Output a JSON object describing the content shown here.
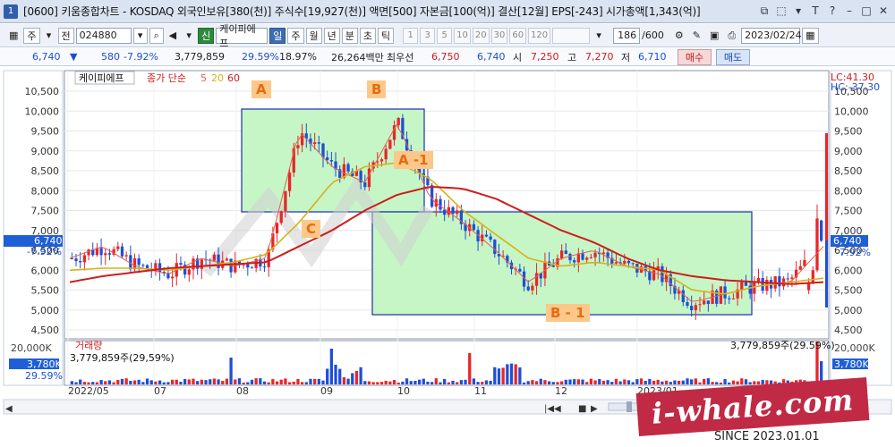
{
  "window": {
    "app_num": "1",
    "title": "[0600] 키움종합차트 - KOSDAQ 외국인보유[380(천)] 주식수[19,927(천)] 액면[500] 자본금[100(억)] 결산[12월] EPS[-243] 시가총액[1,343(억)]",
    "controls": [
      "⧉",
      "⬚",
      "▾",
      "T",
      "?",
      "–",
      "□",
      "✕"
    ]
  },
  "toolbar": {
    "menu_label": "주",
    "prev_label": "전",
    "stock_code": "024880",
    "stock_name": "케이피에프",
    "sin_label": "신",
    "periods": [
      "일",
      "주",
      "월",
      "년",
      "분",
      "초",
      "틱"
    ],
    "active_period": "일",
    "intervals": [
      "1",
      "3",
      "5",
      "10",
      "20",
      "30",
      "60",
      "120"
    ],
    "count": "186",
    "count_total": "/600",
    "date": "2023/02/24"
  },
  "quote": {
    "price": "6,740",
    "change": "580",
    "change_pct": "-7.92%",
    "volume": "3,779,859",
    "vol_pct1": "29.59%",
    "vol_pct2": "18.97%",
    "amount": "26,264백만",
    "best_label": "최우선",
    "best_ask": "6,750",
    "best_bid": "6,740",
    "open_label": "시",
    "open": "7,250",
    "high_label": "고",
    "high": "7,270",
    "low_label": "저",
    "low": "6,710",
    "buy_label": "매수",
    "sell_label": "매도"
  },
  "chart": {
    "legend_name": "케이피에프",
    "legend_ma": "종가 단순",
    "ma_periods": [
      "5",
      "20",
      "60"
    ],
    "lc_text": "LC:41.30",
    "hc_text": "HC:-37.30",
    "y_ticks": [
      "10,500",
      "10,000",
      "9,500",
      "9,000",
      "8,500",
      "8,000",
      "7,500",
      "7,000",
      "6,500",
      "6,000",
      "5,500",
      "5,000",
      "4,500"
    ],
    "current_price": "6,740",
    "current_pct": "-7.92%",
    "x_ticks": [
      "2022/05",
      "07",
      "08",
      "09",
      "10",
      "11",
      "12",
      "2023/01"
    ],
    "annotations": [
      "A",
      "B",
      "A -1",
      "C",
      "B - 1"
    ],
    "volume_title": "거래량",
    "volume_label": "3,779,859주(29,59%)",
    "volume_label_right": "3,779,859주(29.59%)",
    "volume_axis_top": "20,000K",
    "volume_current": "3,780K",
    "volume_pct": "29.59%",
    "colors": {
      "up": "#e8262a",
      "down": "#1f4fd6",
      "ma5": "#e4604e",
      "ma20": "#d7b21a",
      "ma60": "#cc1d1d",
      "box": "#c6f5c6",
      "box_border": "#1d2fa8"
    }
  },
  "footer": {
    "brand": "i-whale.com",
    "since": "SINCE 2023.01.01"
  },
  "chart_data": {
    "type": "candlestick",
    "y_axis": {
      "min": 4500,
      "max": 10500
    },
    "ma_series": [
      {
        "name": "5",
        "values": [
          6300,
          6600,
          6100,
          5900,
          6300,
          6100,
          6300,
          9500,
          8600,
          8200,
          9700,
          7800,
          7200,
          6500,
          5700,
          6300,
          6500,
          6100,
          5900,
          5200,
          5400,
          5600,
          5700,
          6600
        ]
      },
      {
        "name": "20",
        "values": [
          6000,
          6050,
          6050,
          6000,
          6100,
          6200,
          6400,
          7200,
          8200,
          8600,
          8700,
          8300,
          7500,
          6900,
          6300,
          6100,
          6200,
          6100,
          6000,
          5500,
          5400,
          5600,
          5700,
          5800
        ]
      },
      {
        "name": "60",
        "values": [
          5700,
          5850,
          5950,
          6050,
          6100,
          6150,
          6200,
          6600,
          7000,
          7500,
          7900,
          8100,
          8050,
          7800,
          7400,
          7000,
          6700,
          6300,
          6000,
          5850,
          5750,
          5700,
          5650,
          5700
        ]
      }
    ],
    "last_candle": {
      "open": 7250,
      "high": 7270,
      "low": 6710,
      "close": 6740
    }
  }
}
